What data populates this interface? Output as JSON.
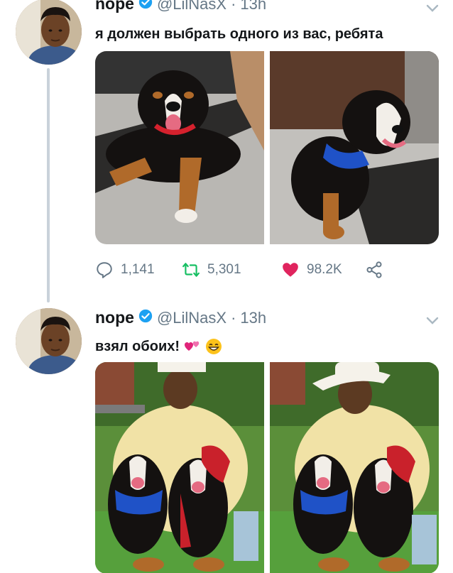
{
  "tweets": [
    {
      "name": "nope",
      "handle": "@LilNasX",
      "separator": "·",
      "time": "13h",
      "text": "я должен выбрать одного из вас, ребята",
      "stats": {
        "replies": "1,141",
        "retweets": "5,301",
        "likes": "98.2K"
      },
      "photos": [
        "dog-lying-on-mat",
        "dog-sitting-blue-harness"
      ]
    },
    {
      "name": "nope",
      "handle": "@LilNasX",
      "separator": "·",
      "time": "13h",
      "text": "взял обоих!",
      "emojis": [
        "two-hearts-emoji",
        "grinning-face-emoji"
      ],
      "photos": [
        "man-with-two-puppies",
        "man-with-cowboy-hat-and-two-puppies"
      ]
    }
  ],
  "icons": {
    "verified": "verified-badge-icon",
    "caret": "chevron-down-icon",
    "reply": "reply-icon",
    "retweet": "retweet-icon",
    "like": "heart-icon",
    "share": "share-icon"
  },
  "colors": {
    "verified": "#1da1f2",
    "retweet": "#17bf63",
    "like": "#e0245e",
    "secondary_text": "#657786",
    "thread_line": "#c9d2da"
  }
}
